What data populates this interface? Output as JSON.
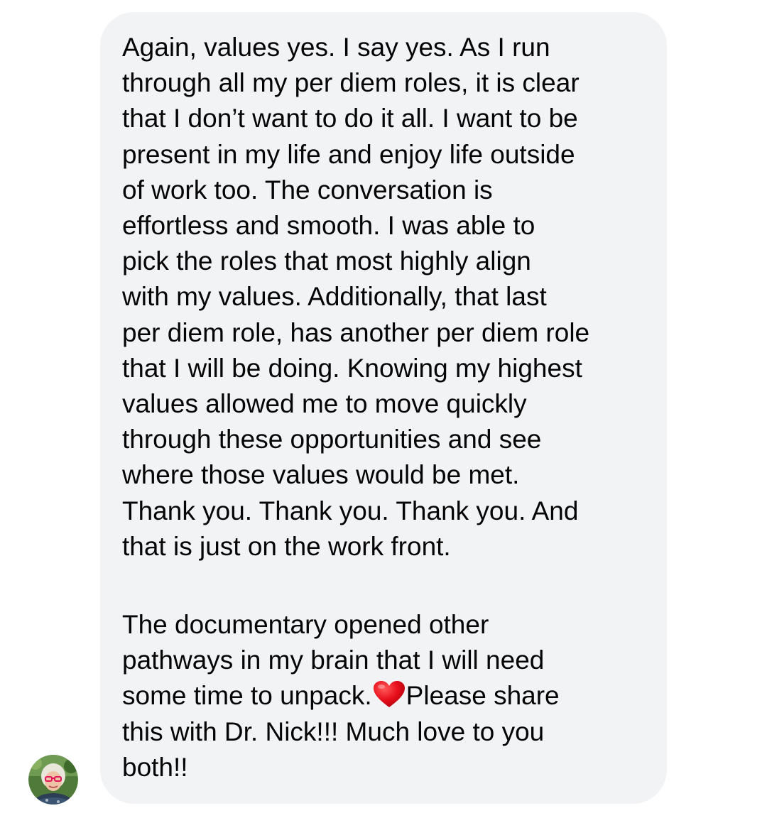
{
  "message": {
    "paragraph1_lines": [
      "Again, values yes. I say yes. As I run",
      "through all my per diem roles, it is clear",
      "that I don’t want to do it all. I want to be",
      "present in my life and enjoy life outside",
      "of work too. The conversation is",
      "effortless and smooth. I was able to",
      "pick the roles that most highly align",
      "with my values. Additionally, that last",
      "per diem role, has another per diem role",
      "that I will be doing. Knowing my highest",
      "values allowed me to move quickly",
      "through these opportunities and see",
      "where those values would be met.",
      "Thank you. Thank you. Thank you. And",
      "that is just on the work front."
    ],
    "paragraph2_lines": [
      "The documentary opened other",
      "pathways in my brain that I will need"
    ],
    "paragraph2_emoji_line_before": "some time to unpack.",
    "paragraph2_emoji_line_after": "Please share",
    "paragraph2_tail_lines": [
      "this with Dr. Nick!!! Much love to you",
      "both!!"
    ]
  },
  "emoji": {
    "name": "red-heart-icon",
    "color": "#e8101c"
  },
  "avatar": {
    "name": "sender-avatar"
  },
  "colors": {
    "bubble_background": "#f2f3f5",
    "text": "#050505",
    "page_background": "#ffffff"
  }
}
